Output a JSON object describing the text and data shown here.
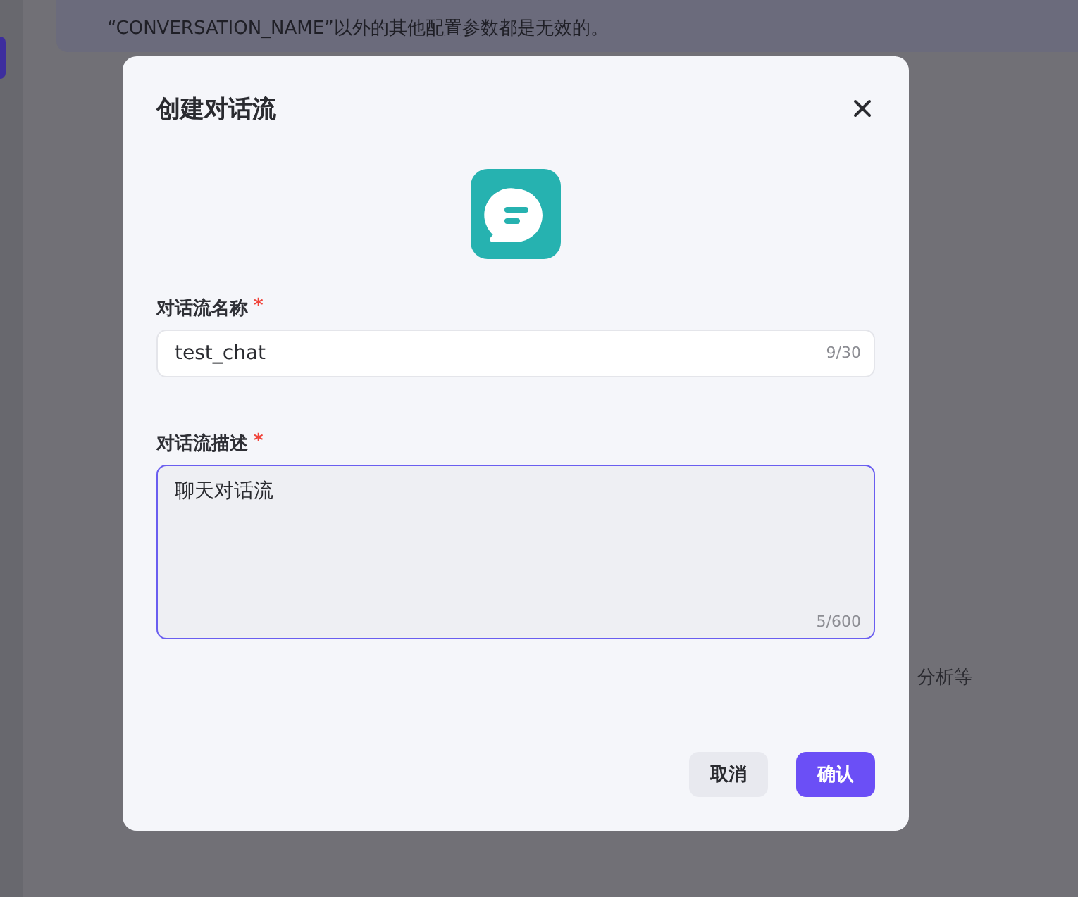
{
  "background": {
    "notice_lines": [
      "“CONVERSATION_NAME”以外的其他配置参数都是无效的。"
    ],
    "description_fragment": "分析等"
  },
  "dialog": {
    "title": "创建对话流",
    "fields": [
      {
        "kind": "input",
        "label": "对话流名称",
        "required_mark": "*",
        "value": "test_chat",
        "counter": "9/30",
        "focused": false
      },
      {
        "kind": "textarea",
        "label": "对话流描述",
        "required_mark": "*",
        "value": "聊天对话流",
        "counter": "5/600",
        "focused": true
      }
    ],
    "buttons": [
      {
        "kind": "secondary",
        "label": "取消"
      },
      {
        "kind": "primary",
        "label": "确认"
      }
    ]
  }
}
